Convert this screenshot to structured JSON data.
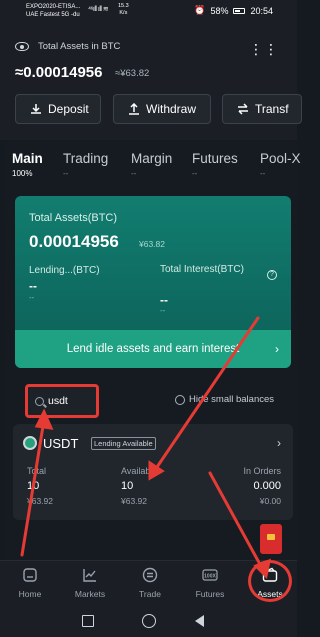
{
  "status_bar": {
    "carrier1": "EXPO2020-ETISA...",
    "carrier2": "UAE Fastest 5G -du",
    "signal": "⁴⁶ıll ıll ≋",
    "speed_value": "15.3",
    "speed_unit": "K/s",
    "battery": "58%",
    "time": "20:54"
  },
  "header": {
    "total_label": "Total Assets in BTC",
    "total_value": "≈0.00014956",
    "total_usd": "≈¥63.82",
    "more_icon": "⋮⋮",
    "buttons": [
      {
        "label": "Deposit",
        "icon": "download-icon"
      },
      {
        "label": "Withdraw",
        "icon": "upload-icon"
      },
      {
        "label": "Transf",
        "icon": "swap-icon"
      }
    ]
  },
  "tabs": [
    {
      "name": "Main",
      "pct": "100%"
    },
    {
      "name": "Trading",
      "pct": "--"
    },
    {
      "name": "Margin",
      "pct": "--"
    },
    {
      "name": "Futures",
      "pct": "--"
    },
    {
      "name": "Pool-X",
      "pct": "--"
    }
  ],
  "main_card": {
    "title": "Total Assets(BTC)",
    "value": "0.00014956",
    "value_usd": "¥63.82",
    "lending_label": "Lending...(BTC)",
    "lending_value": "--",
    "lending_sub": "--",
    "interest_label": "Total Interest(BTC)",
    "interest_value": "--",
    "interest_sub": "--",
    "help": "?",
    "cta": "Lend idle assets and earn interest",
    "cta_arrow": "›"
  },
  "search": {
    "value": "usdt",
    "hide_small": "Hide small balances"
  },
  "coin": {
    "name": "USDT",
    "badge": "Lending Available",
    "chevron": "›",
    "total_h": "Total",
    "total_v": "10",
    "total_s": "¥63.92",
    "avail_h": "Available",
    "avail_v": "10",
    "avail_s": "¥63.92",
    "order_h": "In Orders",
    "order_v": "0.000",
    "order_s": "¥0.00"
  },
  "nav": [
    {
      "label": "Home"
    },
    {
      "label": "Markets"
    },
    {
      "label": "Trade"
    },
    {
      "label": "Futures",
      "badge": "100X"
    },
    {
      "label": "Assets"
    }
  ],
  "colors": {
    "accent_green": "#1fa283",
    "annotation_red": "#e63b34"
  }
}
